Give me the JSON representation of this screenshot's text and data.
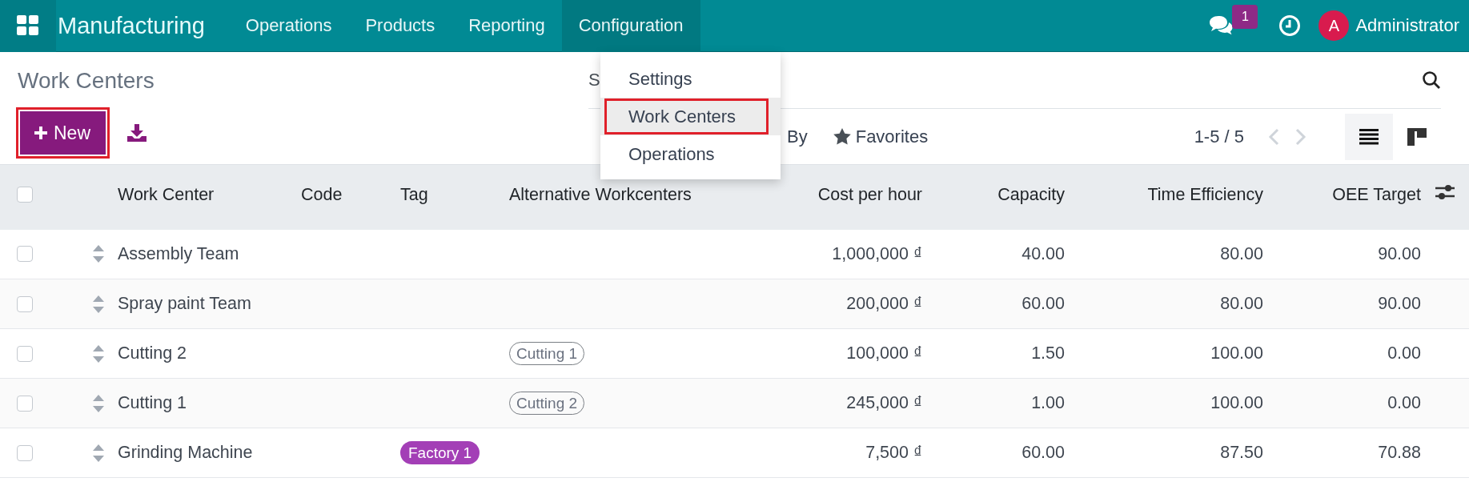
{
  "navbar": {
    "app_name": "Manufacturing",
    "menus": [
      {
        "label": "Operations",
        "selected": false
      },
      {
        "label": "Products",
        "selected": false
      },
      {
        "label": "Reporting",
        "selected": false
      },
      {
        "label": "Configuration",
        "selected": true
      }
    ],
    "messages_badge": "1",
    "user": {
      "initial": "A",
      "name": "Administrator"
    }
  },
  "dropdown": {
    "items": [
      {
        "label": "Settings",
        "selected": false,
        "highlighted": false
      },
      {
        "label": "Work Centers",
        "selected": true,
        "highlighted": true
      },
      {
        "label": "Operations",
        "selected": false,
        "highlighted": false
      }
    ]
  },
  "control_panel": {
    "title": "Work Centers",
    "new_button": {
      "label": "New",
      "highlighted": true
    },
    "search": {
      "placeholder": "S"
    },
    "filters": [
      {
        "kind": "group_by",
        "label": "By"
      },
      {
        "kind": "favorites",
        "label": "Favorites"
      }
    ],
    "pager": "1-5 / 5",
    "views": [
      {
        "kind": "list",
        "selected": true
      },
      {
        "kind": "kanban",
        "selected": false
      }
    ]
  },
  "table": {
    "select_all_checked": false,
    "columns": [
      "Work Center",
      "Code",
      "Tag",
      "Alternative Workcenters",
      "Cost per hour",
      "Capacity",
      "Time Efficiency",
      "OEE Target"
    ],
    "rows": [
      {
        "checked": false,
        "name": "Assembly Team",
        "tags": [],
        "alternatives": [],
        "cost": "1,000,000 ₫",
        "capacity": "40.00",
        "time_efficiency": "80.00",
        "oee_target": "90.00"
      },
      {
        "checked": false,
        "name": "Spray paint Team",
        "tags": [],
        "alternatives": [],
        "cost": "200,000 ₫",
        "capacity": "60.00",
        "time_efficiency": "80.00",
        "oee_target": "90.00"
      },
      {
        "checked": false,
        "name": "Cutting 2",
        "tags": [],
        "alternatives": [
          "Cutting 1"
        ],
        "cost": "100,000 ₫",
        "capacity": "1.50",
        "time_efficiency": "100.00",
        "oee_target": "0.00"
      },
      {
        "checked": false,
        "name": "Cutting 1",
        "tags": [],
        "alternatives": [
          "Cutting 2"
        ],
        "cost": "245,000 ₫",
        "capacity": "1.00",
        "time_efficiency": "100.00",
        "oee_target": "0.00"
      },
      {
        "checked": false,
        "name": "Grinding Machine",
        "tags": [
          {
            "label": "Factory 1",
            "color": "#a33fb6"
          }
        ],
        "alternatives": [],
        "cost": "7,500 ₫",
        "capacity": "60.00",
        "time_efficiency": "87.50",
        "oee_target": "70.88"
      }
    ]
  }
}
